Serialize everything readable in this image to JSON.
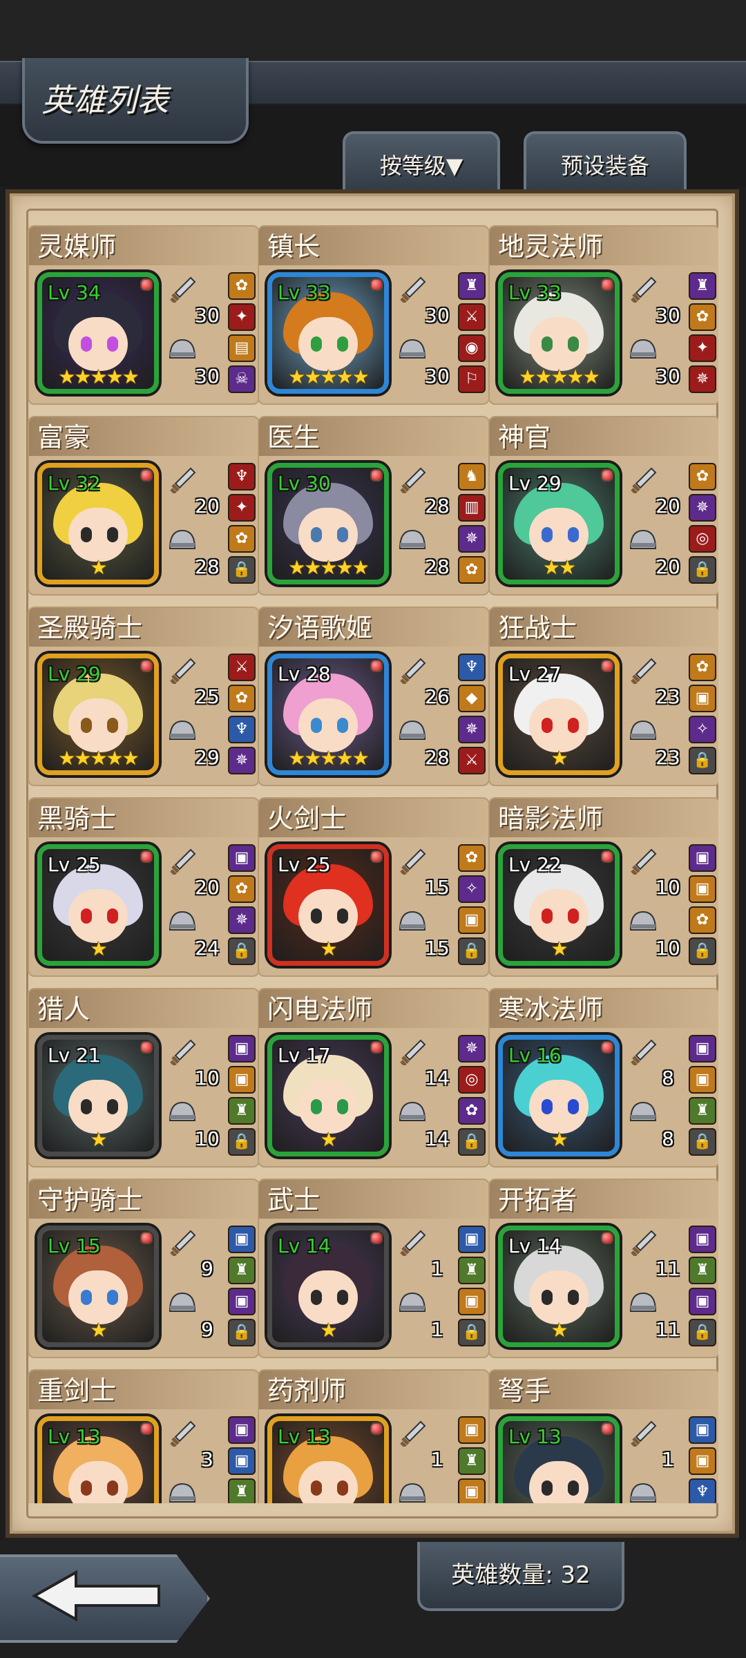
{
  "header": {
    "title": "英雄列表",
    "sort_label": "按等级▼",
    "preset_label": "预设装备"
  },
  "footer": {
    "count_label": "英雄数量: 32"
  },
  "colors": {
    "panel": "#dcc7a6",
    "lv_green": "#39d02f",
    "star": "#ffd22a"
  },
  "heroes": [
    {
      "name": "灵媒师",
      "lv": "Lv 34",
      "lv_color": "green",
      "stars": "★★★★★",
      "atk": "30",
      "def": "30",
      "frame": "#2aa43a",
      "bg": "#3a2a5a",
      "hair": "#2b2b3b",
      "eye": "#c24fe0",
      "slots": [
        [
          "orange",
          "✿"
        ],
        [
          "red",
          "✦"
        ],
        [
          "orange",
          "▤"
        ],
        [
          "purple",
          "☠"
        ]
      ]
    },
    {
      "name": "镇长",
      "lv": "Lv 33",
      "lv_color": "green",
      "stars": "★★★★★",
      "atk": "30",
      "def": "30",
      "frame": "#2e86d6",
      "bg": "#6fa5c8",
      "hair": "#d47b1e",
      "eye": "#2f9e3f",
      "slots": [
        [
          "purple",
          "♜"
        ],
        [
          "red",
          "⚔"
        ],
        [
          "red",
          "◉"
        ],
        [
          "red",
          "⚐"
        ]
      ]
    },
    {
      "name": "地灵法师",
      "lv": "Lv 33",
      "lv_color": "green",
      "stars": "★★★★★",
      "atk": "30",
      "def": "30",
      "frame": "#2aa43a",
      "bg": "#7d8a78",
      "hair": "#e8e8e0",
      "eye": "#3a8a46",
      "slots": [
        [
          "purple",
          "♜"
        ],
        [
          "orange",
          "✿"
        ],
        [
          "red",
          "✦"
        ],
        [
          "red",
          "✵"
        ]
      ]
    },
    {
      "name": "富豪",
      "lv": "Lv 32",
      "lv_color": "green",
      "stars": "★",
      "atk": "20",
      "def": "28",
      "frame": "#e0a020",
      "bg": "#5a5a40",
      "hair": "#f0d040",
      "eye": "#2a2a2a",
      "slots": [
        [
          "red",
          "♆"
        ],
        [
          "red",
          "✦"
        ],
        [
          "orange",
          "✿"
        ],
        [
          "lock",
          "🔒"
        ]
      ]
    },
    {
      "name": "医生",
      "lv": "Lv 30",
      "lv_color": "green",
      "stars": "★★★★★",
      "atk": "28",
      "def": "28",
      "frame": "#2aa43a",
      "bg": "#3a3550",
      "hair": "#8a8aa0",
      "eye": "#4a7ab0",
      "slots": [
        [
          "orange",
          "♞"
        ],
        [
          "red",
          "▥"
        ],
        [
          "purple",
          "✵"
        ],
        [
          "orange",
          "✿"
        ]
      ]
    },
    {
      "name": "神官",
      "lv": "Lv 29",
      "lv_color": "white",
      "stars": "★★",
      "atk": "20",
      "def": "20",
      "frame": "#2aa43a",
      "bg": "#4a7a6a",
      "hair": "#4fc89a",
      "eye": "#3a6ad0",
      "slots": [
        [
          "orange",
          "✿"
        ],
        [
          "purple",
          "✵"
        ],
        [
          "red",
          "◎"
        ],
        [
          "lock",
          "🔒"
        ]
      ]
    },
    {
      "name": "圣殿骑士",
      "lv": "Lv 29",
      "lv_color": "green",
      "stars": "★★★★★",
      "atk": "25",
      "def": "29",
      "frame": "#e0a020",
      "bg": "#7a5a2a",
      "hair": "#e8d27a",
      "eye": "#8a5a1a",
      "slots": [
        [
          "red",
          "⚔"
        ],
        [
          "orange",
          "✿"
        ],
        [
          "blue",
          "♆"
        ],
        [
          "purple",
          "✵"
        ]
      ]
    },
    {
      "name": "汐语歌姬",
      "lv": "Lv 28",
      "lv_color": "white",
      "stars": "★★★★★",
      "atk": "26",
      "def": "28",
      "frame": "#2e86d6",
      "bg": "#6a5a8a",
      "hair": "#f0a0d0",
      "eye": "#3a8ad0",
      "slots": [
        [
          "blue",
          "♆"
        ],
        [
          "orange",
          "◆"
        ],
        [
          "purple",
          "✵"
        ],
        [
          "red",
          "⚔"
        ]
      ]
    },
    {
      "name": "狂战士",
      "lv": "Lv 27",
      "lv_color": "white",
      "stars": "★",
      "atk": "23",
      "def": "23",
      "frame": "#e0a020",
      "bg": "#5a4a3a",
      "hair": "#f0f0f0",
      "eye": "#d02020",
      "slots": [
        [
          "orange",
          "✿"
        ],
        [
          "orange",
          "▣"
        ],
        [
          "purple",
          "✧"
        ],
        [
          "lock",
          "🔒"
        ]
      ]
    },
    {
      "name": "黑骑士",
      "lv": "Lv 25",
      "lv_color": "white",
      "stars": "★",
      "atk": "20",
      "def": "24",
      "frame": "#2aa43a",
      "bg": "#3a3a3a",
      "hair": "#d8d8e8",
      "eye": "#d02020",
      "slots": [
        [
          "purple",
          "▣"
        ],
        [
          "orange",
          "✿"
        ],
        [
          "purple",
          "✵"
        ],
        [
          "lock",
          "🔒"
        ]
      ]
    },
    {
      "name": "火剑士",
      "lv": "Lv 25",
      "lv_color": "white",
      "stars": "★",
      "atk": "15",
      "def": "15",
      "frame": "#d03020",
      "bg": "#5a2a1a",
      "hair": "#e03020",
      "eye": "#2a2a2a",
      "slots": [
        [
          "orange",
          "✿"
        ],
        [
          "purple",
          "✧"
        ],
        [
          "orange",
          "▣"
        ],
        [
          "lock",
          "🔒"
        ]
      ]
    },
    {
      "name": "暗影法师",
      "lv": "Lv 22",
      "lv_color": "white",
      "stars": "★",
      "atk": "10",
      "def": "10",
      "frame": "#2aa43a",
      "bg": "#3a3a3a",
      "hair": "#e8e8e8",
      "eye": "#d02020",
      "slots": [
        [
          "purple",
          "▣"
        ],
        [
          "orange",
          "▣"
        ],
        [
          "orange",
          "✿"
        ],
        [
          "lock",
          "🔒"
        ]
      ]
    },
    {
      "name": "猎人",
      "lv": "Lv 21",
      "lv_color": "white",
      "stars": "★",
      "atk": "10",
      "def": "10",
      "frame": "#4a4a4a",
      "bg": "#5a6a6a",
      "hair": "#2a6a7a",
      "eye": "#2a2a2a",
      "slots": [
        [
          "purple",
          "▣"
        ],
        [
          "orange",
          "▣"
        ],
        [
          "green",
          "♜"
        ],
        [
          "lock",
          "🔒"
        ]
      ]
    },
    {
      "name": "闪电法师",
      "lv": "Lv 17",
      "lv_color": "white",
      "stars": "★",
      "atk": "14",
      "def": "14",
      "frame": "#2aa43a",
      "bg": "#4a3a5a",
      "hair": "#f0e0c0",
      "eye": "#2a9a4a",
      "slots": [
        [
          "purple",
          "✵"
        ],
        [
          "red",
          "◎"
        ],
        [
          "purple",
          "✿"
        ],
        [
          "lock",
          "🔒"
        ]
      ]
    },
    {
      "name": "寒冰法师",
      "lv": "Lv 16",
      "lv_color": "green",
      "stars": "★",
      "atk": "8",
      "def": "8",
      "frame": "#2e86d6",
      "bg": "#3a5a7a",
      "hair": "#4ad0d0",
      "eye": "#2a4ad0",
      "slots": [
        [
          "purple",
          "▣"
        ],
        [
          "orange",
          "▣"
        ],
        [
          "green",
          "♜"
        ],
        [
          "lock",
          "🔒"
        ]
      ]
    },
    {
      "name": "守护骑士",
      "lv": "Lv 15",
      "lv_color": "green",
      "stars": "★",
      "atk": "9",
      "def": "9",
      "frame": "#4a4a4a",
      "bg": "#6a5a4a",
      "hair": "#b0603a",
      "eye": "#3a7ad0",
      "slots": [
        [
          "blue",
          "▣"
        ],
        [
          "green",
          "♜"
        ],
        [
          "purple",
          "▣"
        ],
        [
          "lock",
          "🔒"
        ]
      ]
    },
    {
      "name": "武士",
      "lv": "Lv 14",
      "lv_color": "green",
      "stars": "★",
      "atk": "1",
      "def": "1",
      "frame": "#4a4a4a",
      "bg": "#4a3a5a",
      "hair": "#3a2a3a",
      "eye": "#2a2a2a",
      "slots": [
        [
          "blue",
          "▣"
        ],
        [
          "green",
          "♜"
        ],
        [
          "orange",
          "▣"
        ],
        [
          "lock",
          "🔒"
        ]
      ]
    },
    {
      "name": "开拓者",
      "lv": "Lv 14",
      "lv_color": "white",
      "stars": "★",
      "atk": "11",
      "def": "11",
      "frame": "#2aa43a",
      "bg": "#5a6a5a",
      "hair": "#d8d8d8",
      "eye": "#2a2a2a",
      "slots": [
        [
          "purple",
          "▣"
        ],
        [
          "green",
          "♜"
        ],
        [
          "purple",
          "▣"
        ],
        [
          "lock",
          "🔒"
        ]
      ]
    },
    {
      "name": "重剑士",
      "lv": "Lv 13",
      "lv_color": "green",
      "stars": "",
      "atk": "3",
      "def": "",
      "frame": "#e0a020",
      "bg": "#6a4a3a",
      "hair": "#f0b060",
      "eye": "#8a3a1a",
      "slots": [
        [
          "purple",
          "▣"
        ],
        [
          "blue",
          "▣"
        ],
        [
          "green",
          "♜"
        ],
        [
          "lock",
          "🔒"
        ]
      ]
    },
    {
      "name": "药剂师",
      "lv": "Lv 13",
      "lv_color": "green",
      "stars": "",
      "atk": "1",
      "def": "",
      "frame": "#e0a020",
      "bg": "#7a4a2a",
      "hair": "#e8a040",
      "eye": "#8a3a1a",
      "slots": [
        [
          "orange",
          "▣"
        ],
        [
          "green",
          "♜"
        ],
        [
          "orange",
          "▣"
        ],
        [
          "lock",
          "🔒"
        ]
      ]
    },
    {
      "name": "弩手",
      "lv": "Lv 13",
      "lv_color": "green",
      "stars": "",
      "atk": "1",
      "def": "",
      "frame": "#2aa43a",
      "bg": "#5a6a5a",
      "hair": "#2a3a4a",
      "eye": "#2a2a2a",
      "slots": [
        [
          "blue",
          "▣"
        ],
        [
          "orange",
          "▣"
        ],
        [
          "blue",
          "♆"
        ],
        [
          "lock",
          "🔒"
        ]
      ]
    }
  ]
}
